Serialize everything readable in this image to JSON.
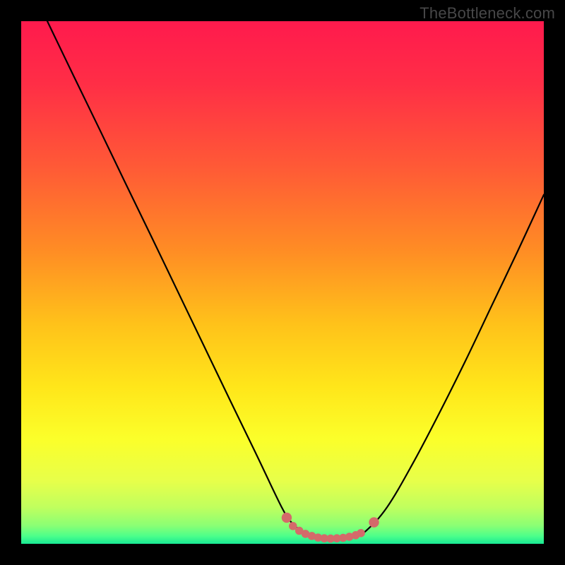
{
  "watermark": "TheBottleneck.com",
  "colors": {
    "gradient_stops": [
      {
        "offset": 0.0,
        "color": "#ff1a4d"
      },
      {
        "offset": 0.12,
        "color": "#ff2e46"
      },
      {
        "offset": 0.28,
        "color": "#ff5a36"
      },
      {
        "offset": 0.44,
        "color": "#ff8d24"
      },
      {
        "offset": 0.58,
        "color": "#ffc21a"
      },
      {
        "offset": 0.7,
        "color": "#ffe61a"
      },
      {
        "offset": 0.8,
        "color": "#fbff2a"
      },
      {
        "offset": 0.88,
        "color": "#e7ff4a"
      },
      {
        "offset": 0.93,
        "color": "#c0ff5e"
      },
      {
        "offset": 0.965,
        "color": "#8bff74"
      },
      {
        "offset": 0.985,
        "color": "#4dff8a"
      },
      {
        "offset": 1.0,
        "color": "#18e994"
      }
    ],
    "curve": "#000000",
    "marker": "#d46a6a"
  },
  "chart_data": {
    "type": "line",
    "title": "",
    "xlabel": "",
    "ylabel": "",
    "xlim": [
      0,
      100
    ],
    "ylim": [
      0,
      100
    ],
    "series": [
      {
        "name": "bottleneck_curve",
        "x": [
          5,
          10,
          15,
          20,
          25,
          30,
          35,
          40,
          45,
          50,
          52,
          54,
          56,
          58,
          60,
          62,
          64,
          66,
          70,
          75,
          80,
          85,
          90,
          95,
          100
        ],
        "y": [
          100,
          89.6,
          79.3,
          68.9,
          58.6,
          48.2,
          37.8,
          27.4,
          17.1,
          6.7,
          3.8,
          2.2,
          1.3,
          1.0,
          1.0,
          1.2,
          1.6,
          2.5,
          7.0,
          15.5,
          25.0,
          35.0,
          45.5,
          56.0,
          66.8
        ]
      }
    ],
    "markers": {
      "name": "optimal_zone",
      "x": [
        50.8,
        52.0,
        53.2,
        54.4,
        55.6,
        56.8,
        58.0,
        59.2,
        60.4,
        61.6,
        62.8,
        64.0,
        65.0,
        67.5
      ],
      "y": [
        5.0,
        3.4,
        2.5,
        1.9,
        1.5,
        1.2,
        1.05,
        1.0,
        1.05,
        1.15,
        1.35,
        1.65,
        2.05,
        3.7
      ]
    }
  }
}
